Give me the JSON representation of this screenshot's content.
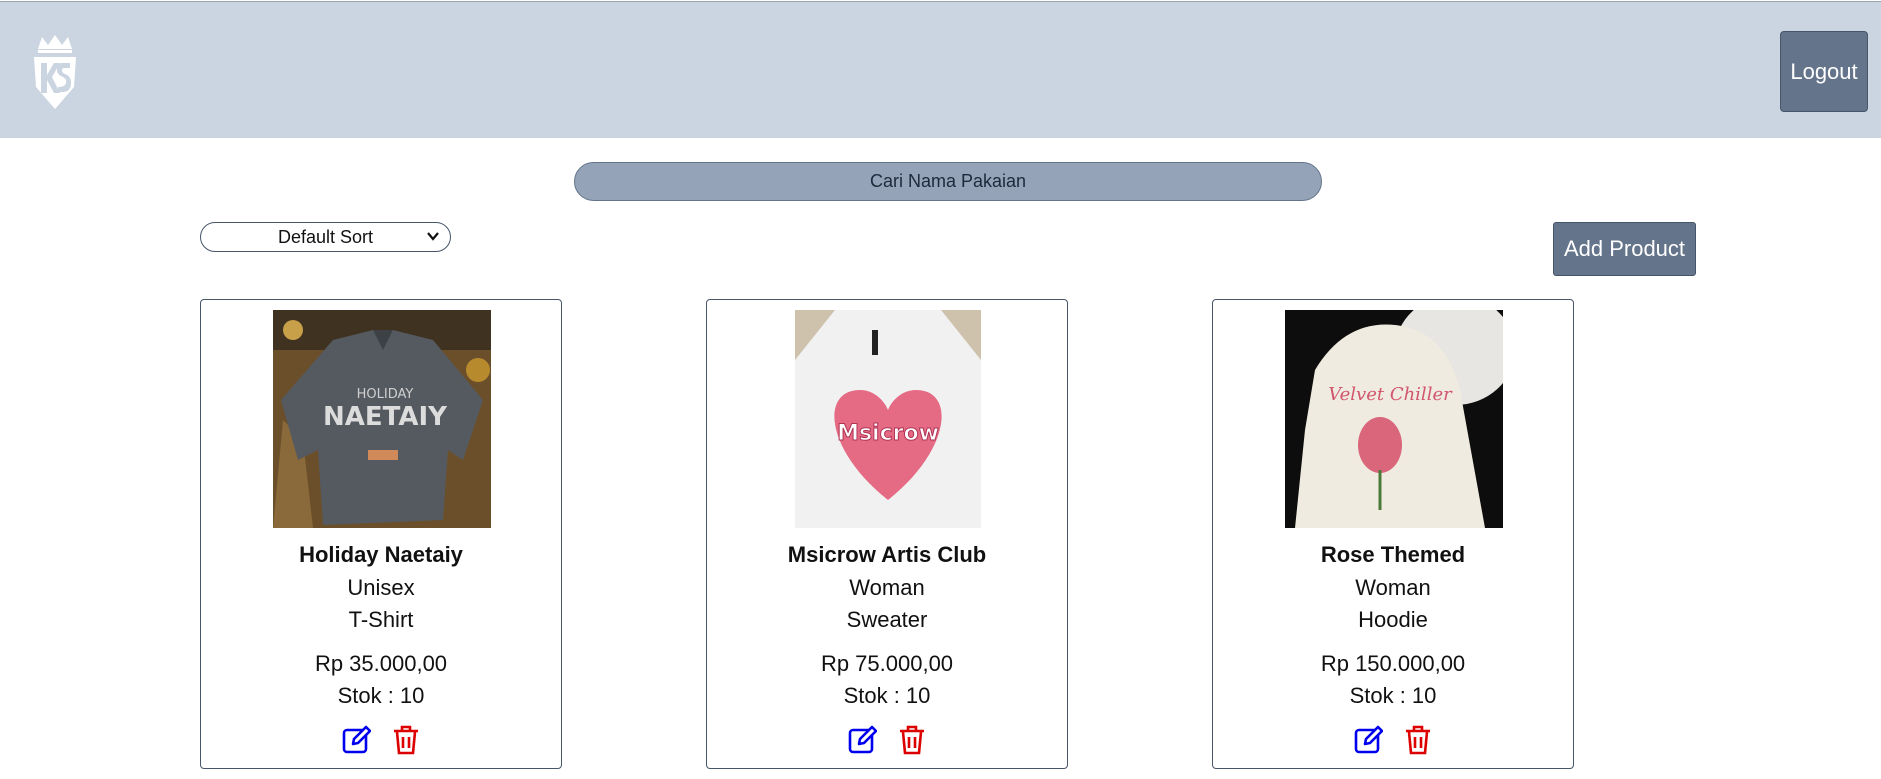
{
  "header": {
    "logout_label": "Logout",
    "logo_icon": "ks-crown-logo"
  },
  "search": {
    "placeholder": "Cari Nama Pakaian"
  },
  "sort": {
    "selected": "Default Sort"
  },
  "add_product_label": "Add Product",
  "colors": {
    "header_bg": "#cbd5e1",
    "button_bg": "#64748b",
    "search_bg": "#94a3b8",
    "edit_icon": "#0000ee",
    "delete_icon": "#dd0000"
  },
  "products": [
    {
      "name": "Holiday Naetaiy",
      "gender": "Unisex",
      "type": "T-Shirt",
      "price": "Rp 35.000,00",
      "stock": "Stok : 10",
      "image": "gray-tshirt-photo"
    },
    {
      "name": "Msicrow Artis Club",
      "gender": "Woman",
      "type": "Sweater",
      "price": "Rp 75.000,00",
      "stock": "Stok : 10",
      "image": "white-sweater-photo"
    },
    {
      "name": "Rose Themed",
      "gender": "Woman",
      "type": "Hoodie",
      "price": "Rp 150.000,00",
      "stock": "Stok : 10",
      "image": "cream-hoodie-photo"
    }
  ]
}
